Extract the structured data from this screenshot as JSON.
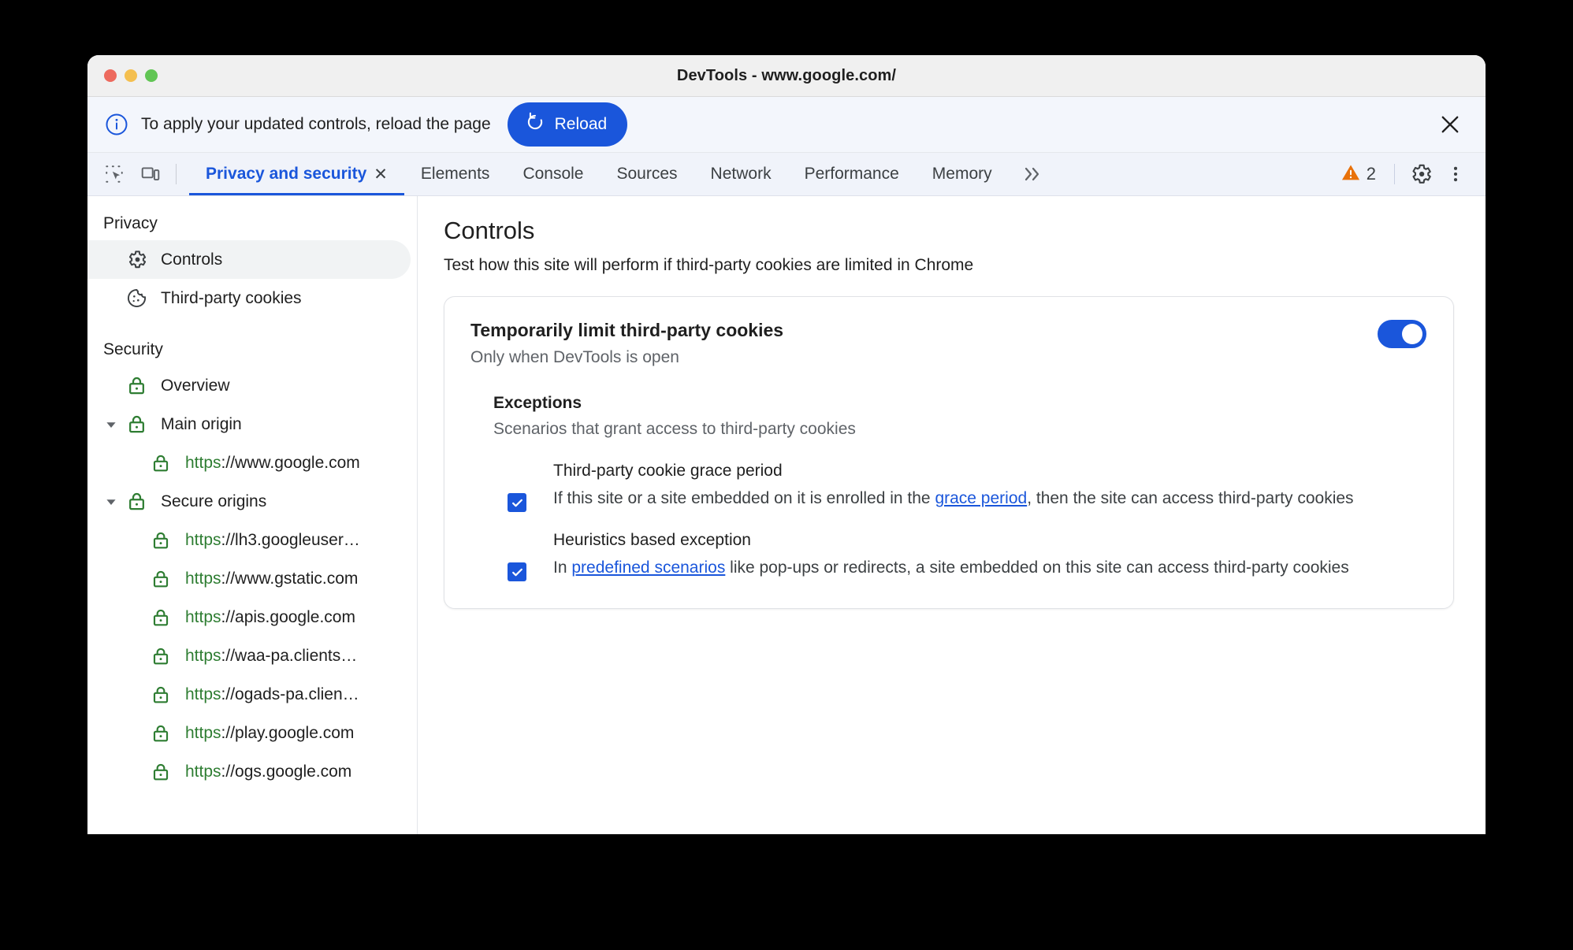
{
  "window": {
    "title": "DevTools - www.google.com/",
    "traffic_lights": [
      "close",
      "minimize",
      "maximize"
    ]
  },
  "banner": {
    "icon": "info-icon",
    "message": "To apply your updated controls, reload the page",
    "reload_label": "Reload",
    "close_icon": "close-icon",
    "accent": "#1a56db"
  },
  "tabbar": {
    "inspect_icon": "inspect-element-icon",
    "device_icon": "device-toolbar-icon",
    "tabs": [
      {
        "label": "Privacy and security",
        "active": true,
        "closable": true
      },
      {
        "label": "Elements",
        "active": false,
        "closable": false
      },
      {
        "label": "Console",
        "active": false,
        "closable": false
      },
      {
        "label": "Sources",
        "active": false,
        "closable": false
      },
      {
        "label": "Network",
        "active": false,
        "closable": false
      },
      {
        "label": "Performance",
        "active": false,
        "closable": false
      },
      {
        "label": "Memory",
        "active": false,
        "closable": false
      }
    ],
    "overflow_label": "»",
    "warning_count": "2",
    "warning_color": "#e8710a",
    "settings_icon": "gear-icon",
    "more_icon": "more-vertical-icon",
    "active_color": "#1a56db"
  },
  "sidebar": {
    "sections": [
      {
        "title": "Privacy",
        "items": [
          {
            "label": "Controls",
            "icon": "gear-icon",
            "indent": 1,
            "selected": true,
            "twisty": "",
            "type": "plain"
          },
          {
            "label": "Third-party cookies",
            "icon": "cookie-icon",
            "indent": 1,
            "selected": false,
            "twisty": "",
            "type": "plain"
          }
        ]
      },
      {
        "title": "Security",
        "items": [
          {
            "label": "Overview",
            "icon": "lock-icon",
            "indent": 1,
            "selected": false,
            "twisty": "",
            "type": "plain"
          },
          {
            "label": "Main origin",
            "icon": "lock-icon",
            "indent": 1,
            "selected": false,
            "twisty": "expanded",
            "type": "plain"
          },
          {
            "label": "https://www.google.com",
            "icon": "lock-icon",
            "indent": 2,
            "selected": false,
            "twisty": "",
            "type": "url"
          },
          {
            "label": "Secure origins",
            "icon": "lock-icon",
            "indent": 1,
            "selected": false,
            "twisty": "expanded",
            "type": "plain"
          },
          {
            "label": "https://lh3.googleuser…",
            "icon": "lock-icon",
            "indent": 2,
            "selected": false,
            "twisty": "",
            "type": "url"
          },
          {
            "label": "https://www.gstatic.com",
            "icon": "lock-icon",
            "indent": 2,
            "selected": false,
            "twisty": "",
            "type": "url"
          },
          {
            "label": "https://apis.google.com",
            "icon": "lock-icon",
            "indent": 2,
            "selected": false,
            "twisty": "",
            "type": "url"
          },
          {
            "label": "https://waa-pa.clients…",
            "icon": "lock-icon",
            "indent": 2,
            "selected": false,
            "twisty": "",
            "type": "url"
          },
          {
            "label": "https://ogads-pa.clien…",
            "icon": "lock-icon",
            "indent": 2,
            "selected": false,
            "twisty": "",
            "type": "url"
          },
          {
            "label": "https://play.google.com",
            "icon": "lock-icon",
            "indent": 2,
            "selected": false,
            "twisty": "",
            "type": "url"
          },
          {
            "label": "https://ogs.google.com",
            "icon": "lock-icon",
            "indent": 2,
            "selected": false,
            "twisty": "",
            "type": "url"
          }
        ]
      }
    ],
    "lock_color": "#2e7d32",
    "scheme_color": "#2e7d32"
  },
  "main": {
    "title": "Controls",
    "subtitle": "Test how this site will perform if third-party cookies are limited in Chrome",
    "card": {
      "title": "Temporarily limit third-party cookies",
      "description": "Only when DevTools is open",
      "toggle_on": true,
      "exceptions": {
        "title": "Exceptions",
        "subtitle": "Scenarios that grant access to third-party cookies",
        "items": [
          {
            "name": "Third-party cookie grace period",
            "checked": true,
            "text_before": "If this site or a site embedded on it is enrolled in the ",
            "link": "grace period",
            "text_after": ", then the site can access third-party cookies"
          },
          {
            "name": "Heuristics based exception",
            "checked": true,
            "text_before": "In ",
            "link": "predefined scenarios",
            "text_after": " like pop-ups or redirects, a site embedded on this site can access third-party cookies"
          }
        ]
      }
    }
  }
}
